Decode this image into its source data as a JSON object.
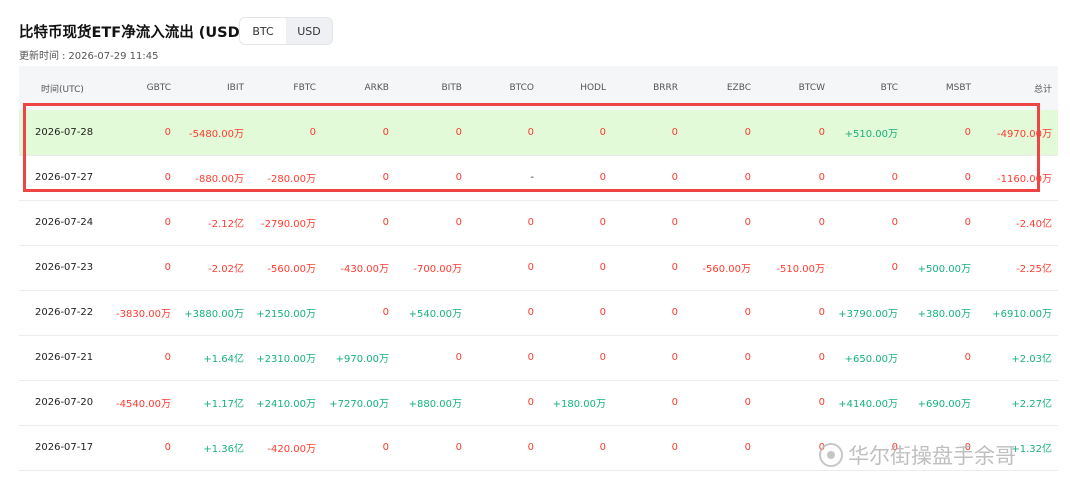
{
  "header": {
    "title": "比特币现货ETF净流入流出 (USD)",
    "toggle": {
      "options": [
        "BTC",
        "USD"
      ],
      "selected": "USD"
    },
    "updated_label": "更新时间",
    "updated_value": "2026-07-29 11:45"
  },
  "table": {
    "columns": [
      "时间(UTC)",
      "GBTC",
      "IBIT",
      "FBTC",
      "ARKB",
      "BITB",
      "BTCO",
      "HODL",
      "BRRR",
      "EZBC",
      "BTCW",
      "BTC",
      "MSBT",
      "总计"
    ],
    "rows": [
      {
        "date": "2026-07-28",
        "highlight": true,
        "cells": [
          "0",
          "-5480.00万",
          "0",
          "0",
          "0",
          "0",
          "0",
          "0",
          "0",
          "0",
          "+510.00万",
          "0",
          "-4970.00万"
        ]
      },
      {
        "date": "2026-07-27",
        "highlight": false,
        "cells": [
          "0",
          "-880.00万",
          "-280.00万",
          "0",
          "0",
          "-",
          "0",
          "0",
          "0",
          "0",
          "0",
          "0",
          "-1160.00万"
        ]
      },
      {
        "date": "2026-07-24",
        "highlight": false,
        "cells": [
          "0",
          "-2.12亿",
          "-2790.00万",
          "0",
          "0",
          "0",
          "0",
          "0",
          "0",
          "0",
          "0",
          "0",
          "-2.40亿"
        ]
      },
      {
        "date": "2026-07-23",
        "highlight": false,
        "cells": [
          "0",
          "-2.02亿",
          "-560.00万",
          "-430.00万",
          "-700.00万",
          "0",
          "0",
          "0",
          "-560.00万",
          "-510.00万",
          "0",
          "+500.00万",
          "-2.25亿"
        ]
      },
      {
        "date": "2026-07-22",
        "highlight": false,
        "cells": [
          "-3830.00万",
          "+3880.00万",
          "+2150.00万",
          "0",
          "+540.00万",
          "0",
          "0",
          "0",
          "0",
          "0",
          "+3790.00万",
          "+380.00万",
          "+6910.00万"
        ]
      },
      {
        "date": "2026-07-21",
        "highlight": false,
        "cells": [
          "0",
          "+1.64亿",
          "+2310.00万",
          "+970.00万",
          "0",
          "0",
          "0",
          "0",
          "0",
          "0",
          "+650.00万",
          "0",
          "+2.03亿"
        ]
      },
      {
        "date": "2026-07-20",
        "highlight": false,
        "cells": [
          "-4540.00万",
          "+1.17亿",
          "+2410.00万",
          "+7270.00万",
          "+880.00万",
          "0",
          "+180.00万",
          "0",
          "0",
          "0",
          "+4140.00万",
          "+690.00万",
          "+2.27亿"
        ]
      },
      {
        "date": "2026-07-17",
        "highlight": false,
        "cells": [
          "0",
          "+1.36亿",
          "-420.00万",
          "0",
          "0",
          "0",
          "0",
          "0",
          "0",
          "0",
          "0",
          "0",
          "+1.32亿"
        ]
      }
    ]
  },
  "watermark": {
    "text": "华尔街操盘手余哥"
  },
  "colors": {
    "negative": "#ff3b30",
    "positive": "#16b27c",
    "highlight_row": "#e2fad7",
    "annotation_box": "#ef4444"
  }
}
